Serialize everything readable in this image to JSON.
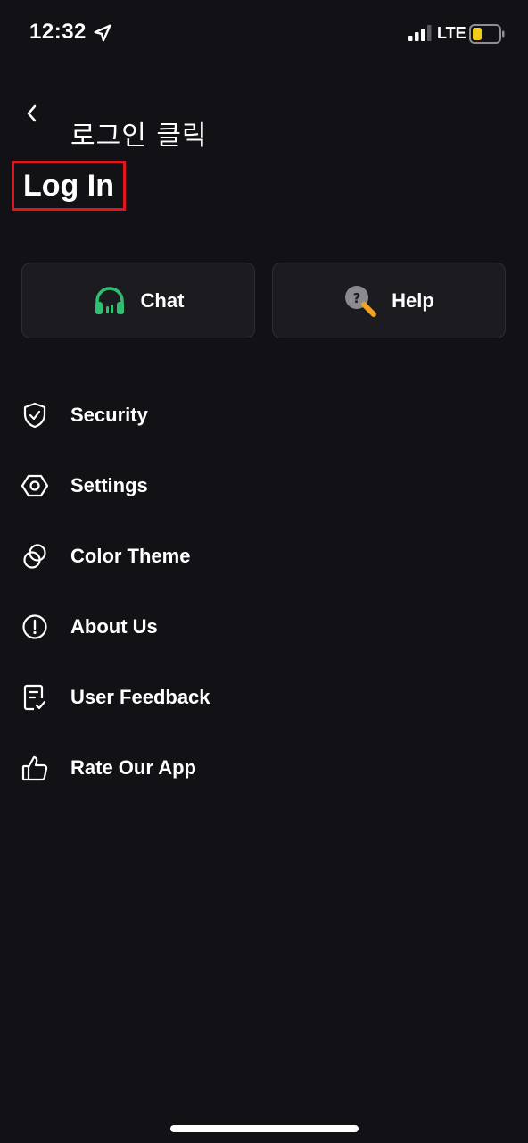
{
  "status_bar": {
    "time": "12:32",
    "network": "LTE",
    "battery_color": "#f2cd1c"
  },
  "header": {
    "annotation": "로그인 클릭",
    "login_label": "Log In",
    "highlight_color": "#e0161c"
  },
  "quick_actions": [
    {
      "label": "Chat",
      "icon": "headset-icon",
      "icon_color": "#2fbf71"
    },
    {
      "label": "Help",
      "icon": "help-search-icon",
      "icon_color": "#f2a21c"
    }
  ],
  "menu": [
    {
      "label": "Security",
      "icon": "shield-icon"
    },
    {
      "label": "Settings",
      "icon": "gear-icon"
    },
    {
      "label": "Color Theme",
      "icon": "color-theme-icon"
    },
    {
      "label": "About Us",
      "icon": "info-icon"
    },
    {
      "label": "User Feedback",
      "icon": "feedback-icon"
    },
    {
      "label": "Rate Our App",
      "icon": "thumbs-up-icon"
    }
  ],
  "colors": {
    "background": "#121116",
    "card_background": "#1b1b20",
    "text": "#ffffff"
  }
}
